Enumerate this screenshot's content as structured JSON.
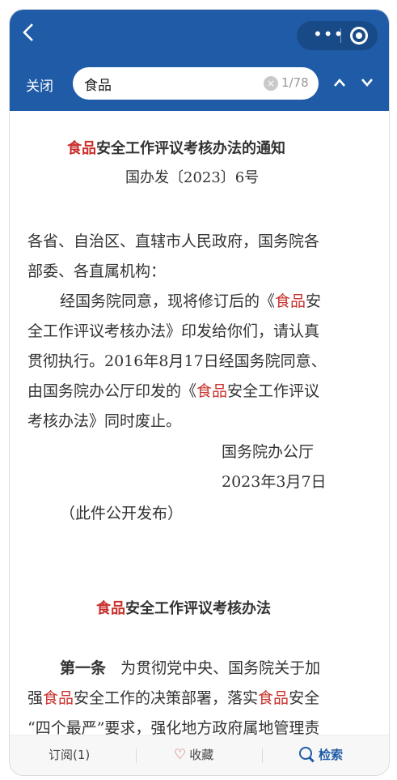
{
  "header": {
    "back_icon": "chevron-left-icon",
    "close_label": "关闭",
    "search_value": "食品",
    "match_count": "1/78",
    "up_icon": "chevron-up-icon",
    "down_icon": "chevron-down-icon",
    "colors": {
      "bar": "#1f5ba6",
      "highlight": "#c9302c"
    }
  },
  "document": {
    "title_hl": "食品",
    "title_rest": "安全工作评议考核办法的通知",
    "doc_number": "国办发〔2023〕6号",
    "addressee_1": "各省、自治区、直辖市人民政府，国务院各",
    "addressee_2": "部委、各直属机构：",
    "p1_l1_a": "经国务院同意，现将修订后的《",
    "p1_l1_hl": "食品",
    "p1_l1_b": "安",
    "p1_l2": "全工作评议考核办法》印发给你们，请认真",
    "p1_l3": "贯彻执行。2016年8月17日经国务院同意、",
    "p1_l4_a": "由国务院办公厅印发的《",
    "p1_l4_hl": "食品",
    "p1_l4_b": "安全工作评议",
    "p1_l5": "考核办法》同时废止。",
    "issuer": "国务院办公厅",
    "date": "2023年3月7日",
    "public_note": "（此件公开发布）",
    "section_title_hl": "食品",
    "section_title_rest": "安全工作评议考核办法",
    "art1_label": "第一条",
    "art1_l1": "为贯彻党中央、国务院关于加",
    "art1_l2_a": "强",
    "art1_l2_hl1": "食品",
    "art1_l2_b": "安全工作的决策部署，落实",
    "art1_l2_hl2": "食品",
    "art1_l2_c": "安全",
    "art1_l3": "“四个最严”要求，强化地方政府属地管理责"
  },
  "bottom_bar": {
    "subscribe_label": "订阅(1)",
    "favorite_icon": "heart-icon",
    "favorite_label": "收藏",
    "search_icon": "search-icon",
    "search_label": "检索"
  }
}
